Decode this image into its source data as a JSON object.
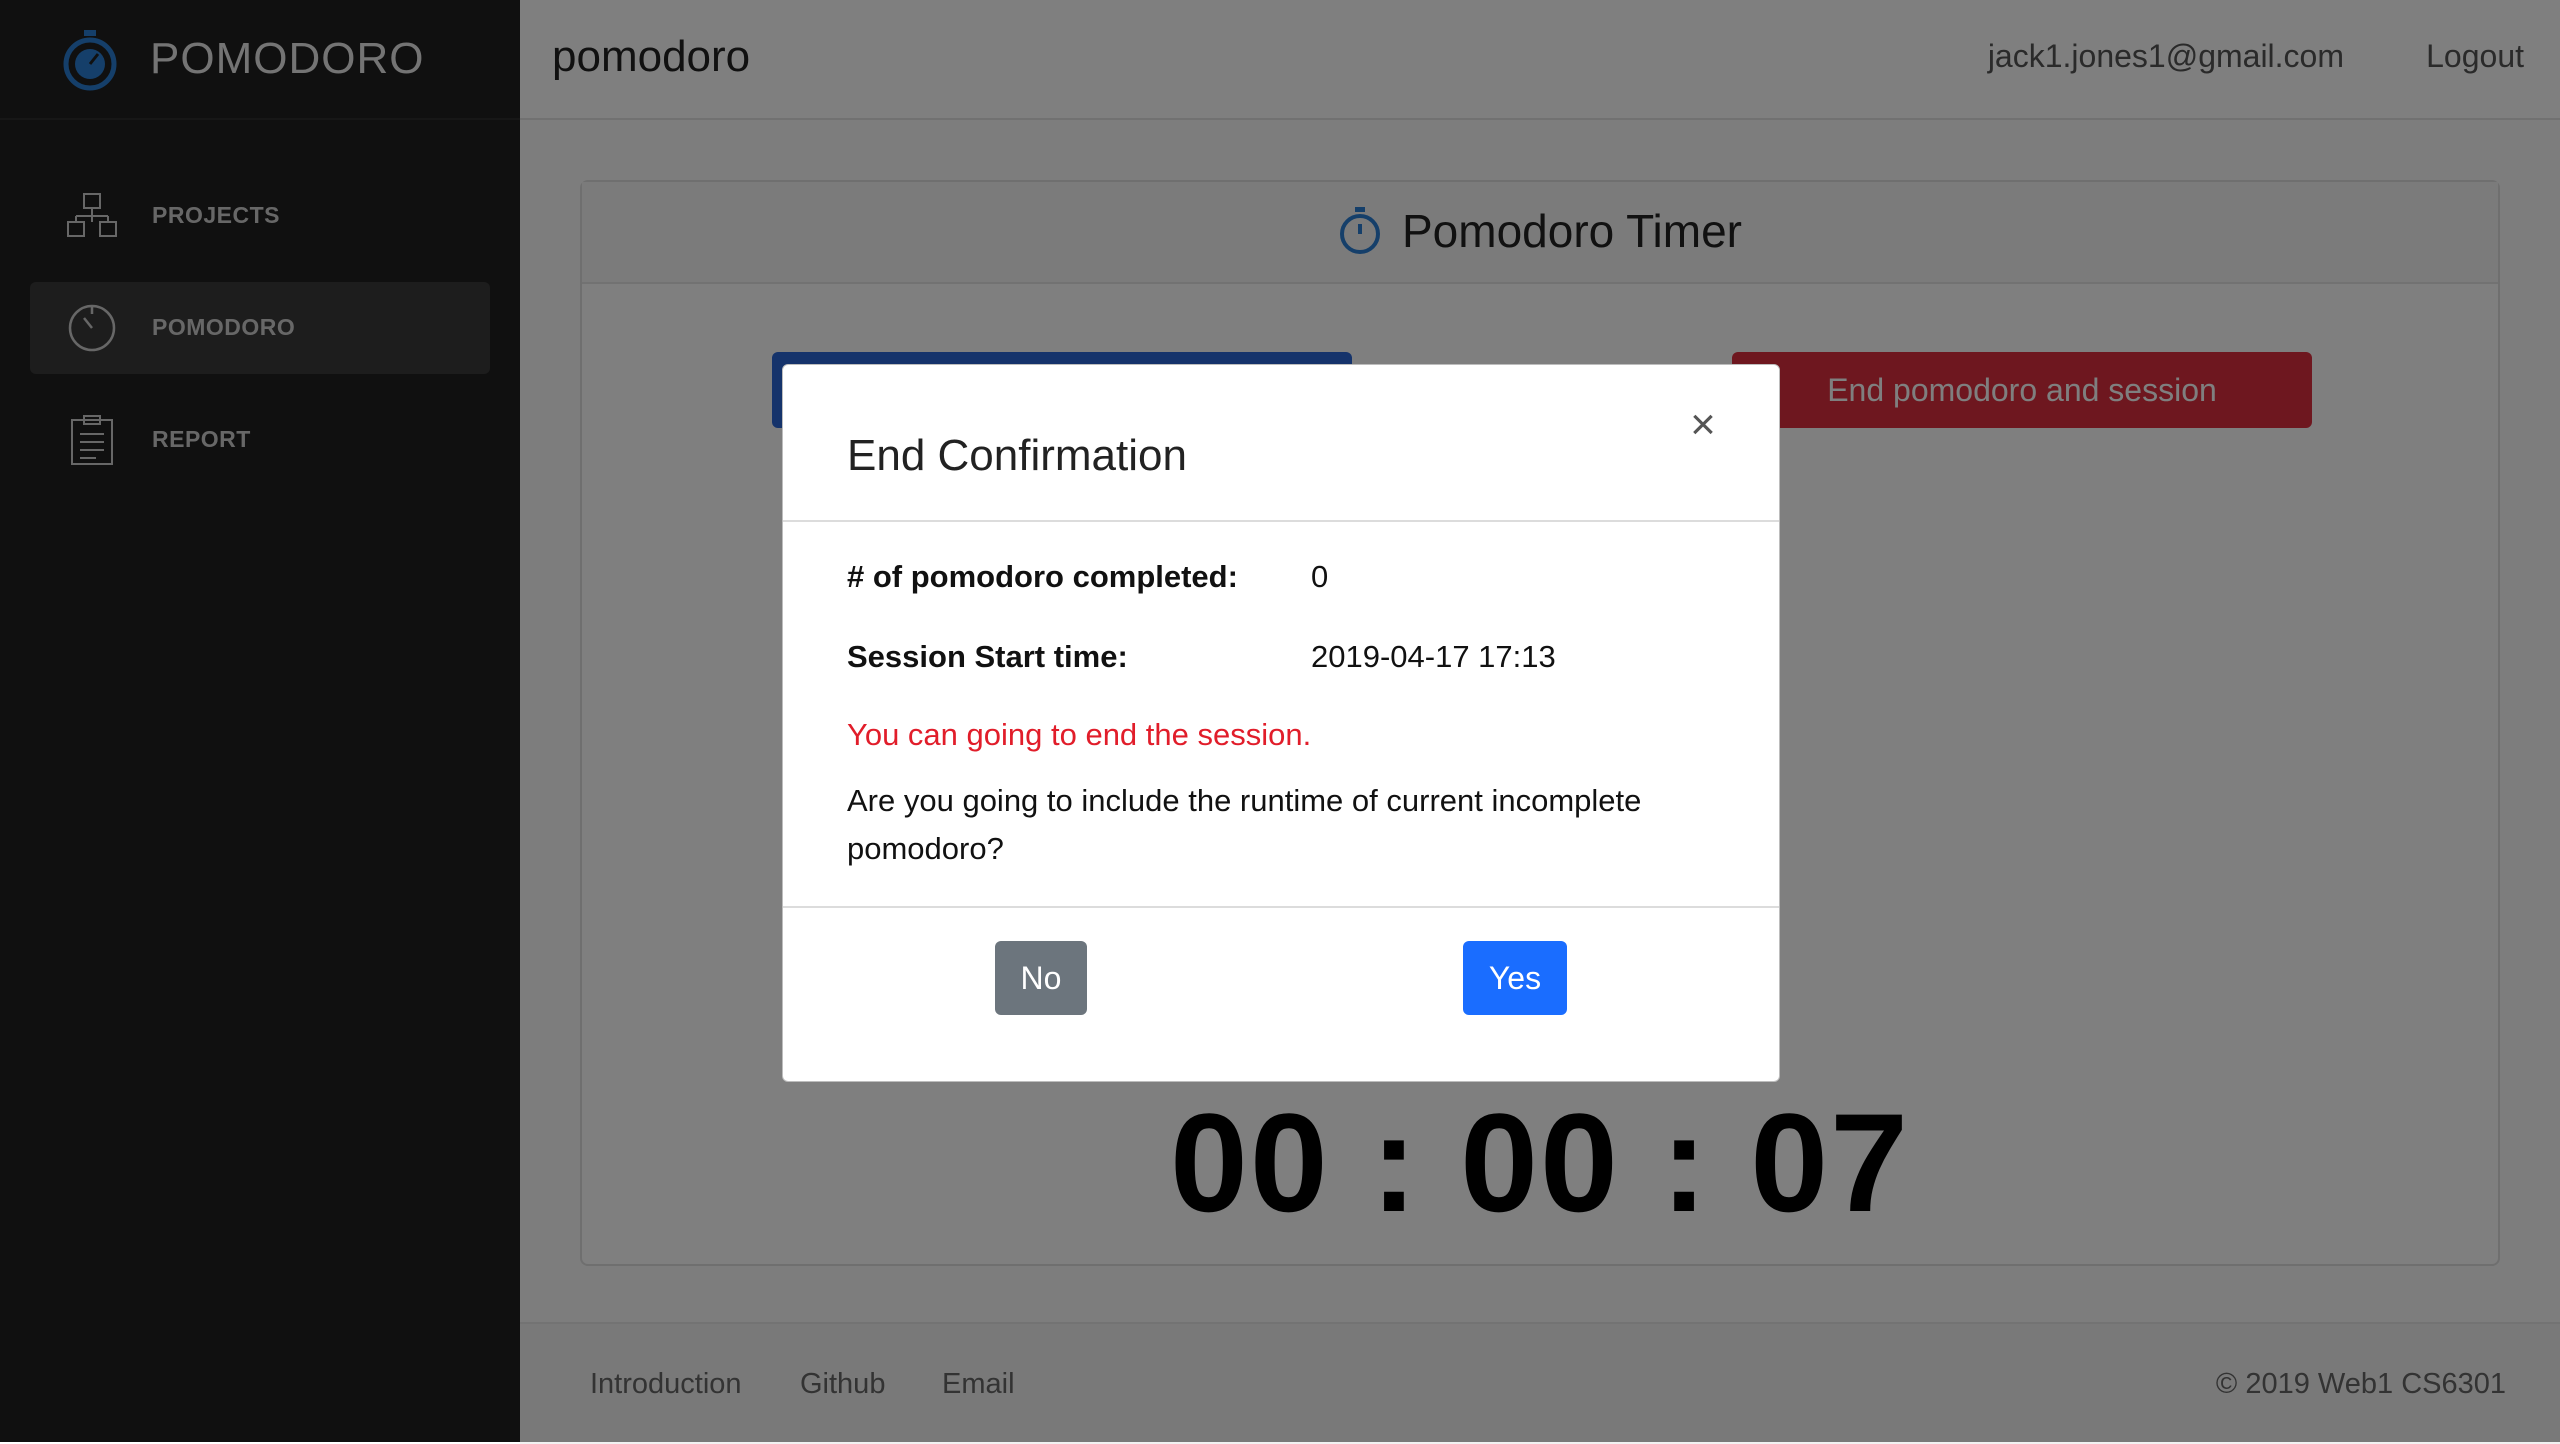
{
  "sidebar": {
    "brand": "POMODORO",
    "items": [
      {
        "label": "PROJECTS",
        "icon": "sitemap-icon",
        "active": false
      },
      {
        "label": "POMODORO",
        "icon": "timer-icon",
        "active": true
      },
      {
        "label": "REPORT",
        "icon": "clipboard-icon",
        "active": false
      }
    ]
  },
  "header": {
    "title": "pomodoro",
    "user_email": "jack1.jones1@gmail.com",
    "logout": "Logout"
  },
  "card": {
    "title": "Pomodoro Timer",
    "end_button": "End pomodoro and session",
    "timer": "00 : 00 : 07"
  },
  "footer": {
    "links": [
      "Introduction",
      "Github",
      "Email"
    ],
    "copyright": "© 2019 Web1 CS6301"
  },
  "modal": {
    "title": "End Confirmation",
    "close": "×",
    "completed_label": "# of pomodoro completed:",
    "completed_value": "0",
    "start_label": "Session Start time:",
    "start_value": "2019-04-17 17:13",
    "warning": "You can going to end the session.",
    "question": "Are you going to include the runtime of current incomplete pomodoro?",
    "no": "No",
    "yes": "Yes"
  },
  "colors": {
    "sidebar_bg": "#212121",
    "accent_blue": "#1a6dff",
    "danger_red": "#dc2f3f",
    "warning_text": "#e11d2a",
    "secondary_gray": "#6c757d"
  }
}
